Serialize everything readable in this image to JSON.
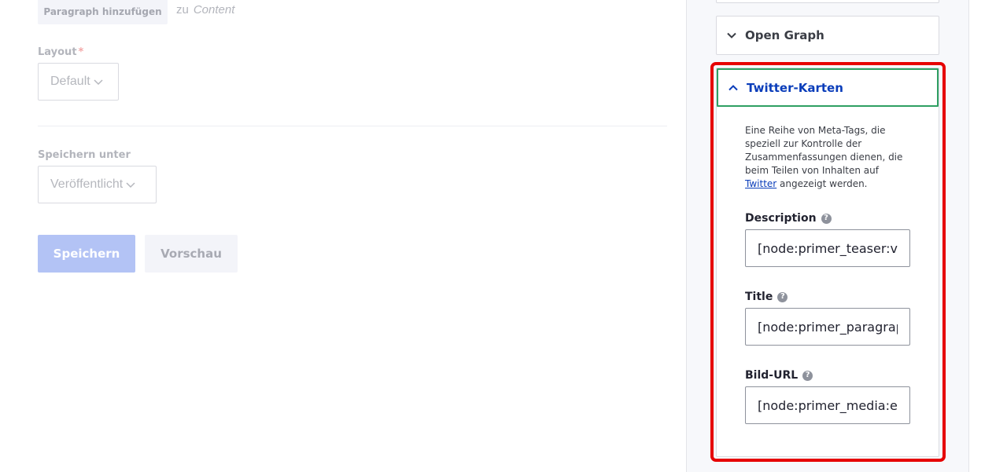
{
  "main": {
    "add_paragraph_label": "Paragraph hinzufügen",
    "to_word": "zu",
    "to_target": "Content",
    "layout": {
      "label": "Layout",
      "required_marker": "*",
      "value": "Default"
    },
    "save_as": {
      "label": "Speichern unter",
      "value": "Veröffentlicht"
    },
    "save_label": "Speichern",
    "preview_label": "Vorschau"
  },
  "sidebar": {
    "open_graph_label": "Open Graph",
    "twitter": {
      "label": "Twitter-Karten",
      "description": "Eine Reihe von Meta-Tags, die speziell zur Kontrolle der Zusammenfassungen dienen, die beim Teilen von Inhalten auf",
      "description_link": "Twitter",
      "description_suffix": "angezeigt werden.",
      "fields": [
        {
          "label": "Description",
          "value": "[node:primer_teaser:value]"
        },
        {
          "label": "Title",
          "value": "[node:primer_paragraph_title]"
        },
        {
          "label": "Bild-URL",
          "value": "[node:primer_media:entity:field_media_image]"
        }
      ]
    }
  },
  "colors": {
    "highlight_border": "#e60000",
    "focus_border": "#2e9f62",
    "link": "#0a3dba",
    "primary_button_disabled": "#b3c3f5"
  }
}
